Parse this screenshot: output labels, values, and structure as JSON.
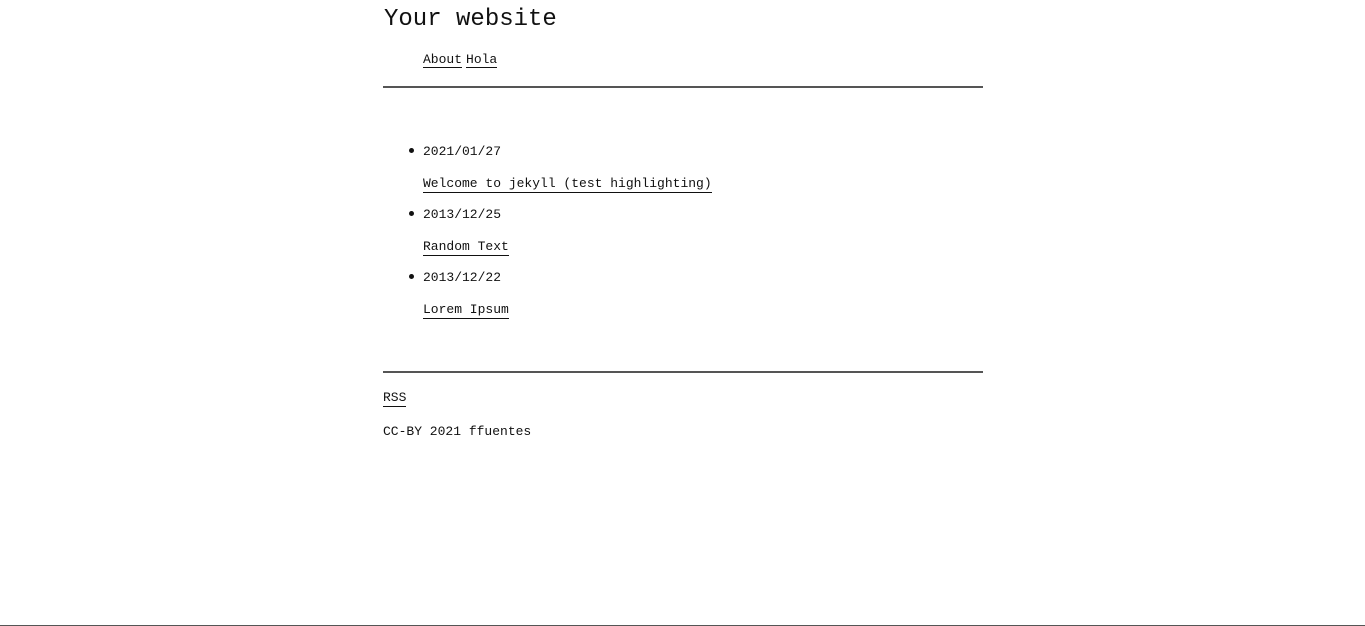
{
  "header": {
    "site_title": "Your website",
    "nav": [
      {
        "label": "About"
      },
      {
        "label": "Hola"
      }
    ]
  },
  "posts": [
    {
      "date": "2021/01/27",
      "title": "Welcome to jekyll (test highlighting)"
    },
    {
      "date": "2013/12/25",
      "title": "Random Text"
    },
    {
      "date": "2013/12/22",
      "title": "Lorem Ipsum"
    }
  ],
  "footer": {
    "rss_label": "RSS",
    "copyright": "CC-BY 2021 ffuentes"
  }
}
